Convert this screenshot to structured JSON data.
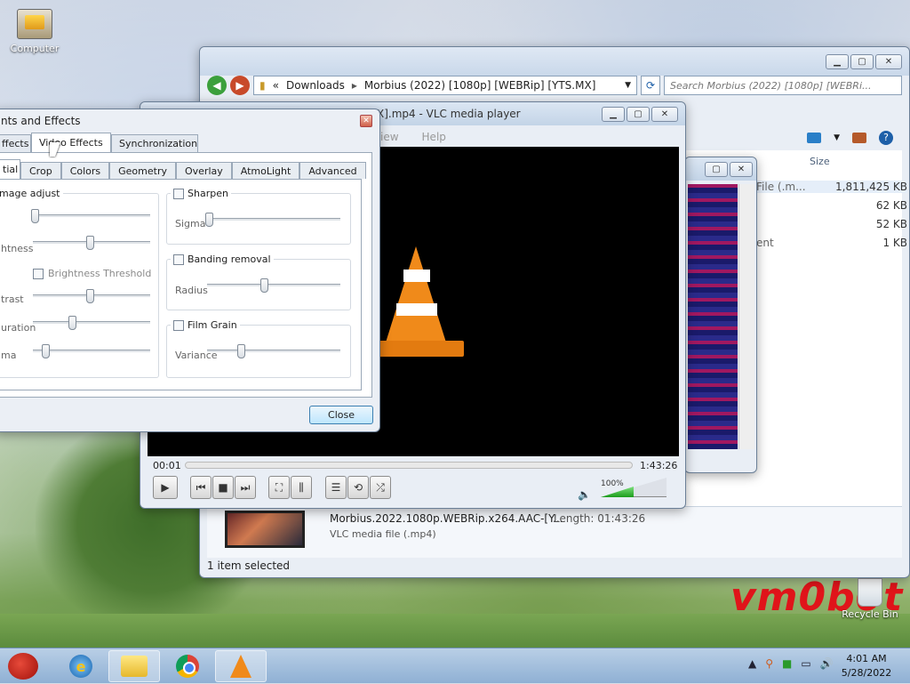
{
  "desktop": {
    "icons": [
      {
        "label": "Computer"
      },
      {
        "label": "Recycle Bin"
      }
    ],
    "watermark": "vm0b0t"
  },
  "explorer": {
    "breadcrumb": [
      "«",
      "Downloads",
      "▸",
      "Morbius (2022) [1080p] [WEBRip] [YTS.MX]"
    ],
    "search_placeholder": "Search Morbius (2022) [1080p] [WEBRi...",
    "column_size": "Size",
    "rows": [
      {
        "name": "File (.m...",
        "size": "1,811,425 KB"
      },
      {
        "name": "",
        "size": "62 KB"
      },
      {
        "name": "",
        "size": "52 KB"
      },
      {
        "name": "ent",
        "size": "1 KB"
      }
    ],
    "details": {
      "name": "Morbius.2022.1080p.WEBRip.x264.AAC-[Y...",
      "length": "Length: 01:43:26",
      "type": "VLC media file (.mp4)"
    },
    "status": "1 item selected"
  },
  "vlc": {
    "title": "X].mp4 - VLC media player",
    "menu": [
      "iew",
      "Help"
    ],
    "time_current": "00:01",
    "time_total": "1:43:26",
    "volume_percent": "100%",
    "volume_level": 1.0
  },
  "adjustments": {
    "title": "nts and Effects",
    "tabs": [
      "ffects",
      "Video Effects",
      "Synchronization"
    ],
    "active_tab": "Video Effects",
    "sub_tabs": [
      "tial",
      "Crop",
      "Colors",
      "Geometry",
      "Overlay",
      "AtmoLight",
      "Advanced"
    ],
    "image_adjust": {
      "title": "mage adjust",
      "labels": [
        "htness",
        "trast",
        "uration",
        "ma"
      ],
      "brightness_threshold": "Brightness Threshold"
    },
    "sharpen": {
      "title": "Sharpen",
      "label": "Sigma"
    },
    "banding": {
      "title": "Banding removal",
      "label": "Radius"
    },
    "grain": {
      "title": "Film Grain",
      "label": "Variance"
    },
    "close_label": "Close"
  },
  "taskbar": {
    "time": "4:01 AM",
    "date": "5/28/2022"
  }
}
